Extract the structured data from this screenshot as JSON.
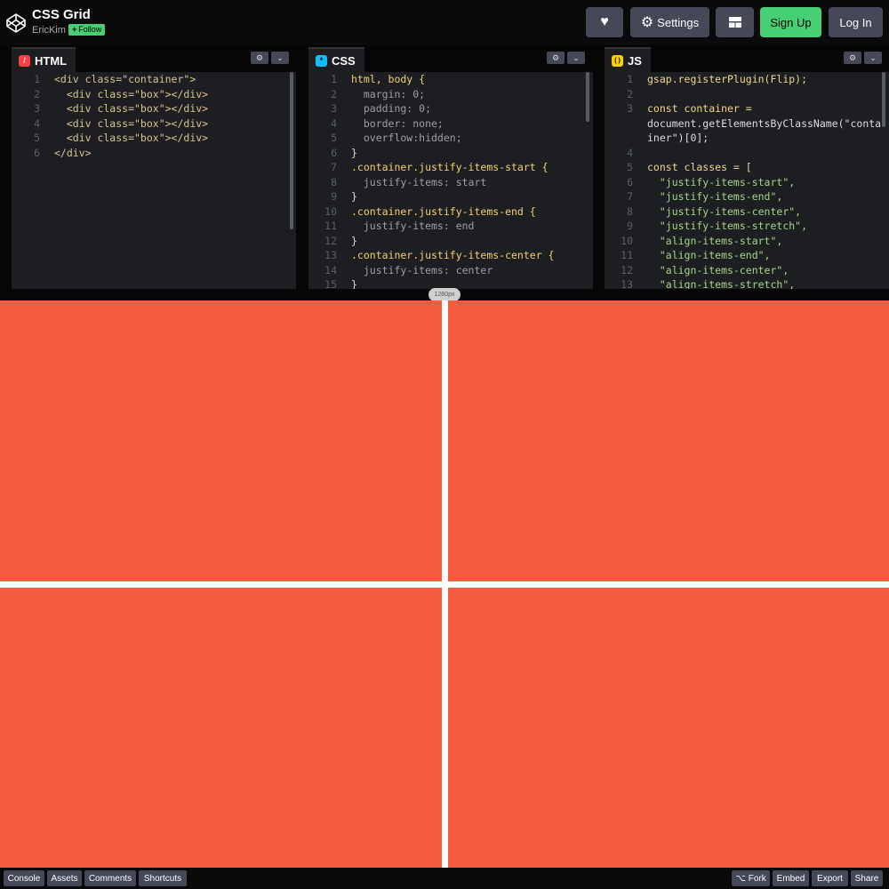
{
  "header": {
    "title": "CSS Grid",
    "author": "EricKim",
    "follow_label": "Follow",
    "follow_plus": "+",
    "heart_icon": "♥",
    "settings_icon": "⚙",
    "settings_label": "Settings",
    "layout_icon": "layout-icon",
    "signup_label": "Sign Up",
    "login_label": "Log In"
  },
  "editors": {
    "html": {
      "label": "HTML",
      "icon_glyph": "/",
      "icon_color": "#ff3c41",
      "lines": [
        [
          "1",
          "<div class=\"container\">"
        ],
        [
          "2",
          "  <div class=\"box\"></div>"
        ],
        [
          "3",
          "  <div class=\"box\"></div>"
        ],
        [
          "4",
          "  <div class=\"box\"></div>"
        ],
        [
          "5",
          "  <div class=\"box\"></div>"
        ],
        [
          "6",
          "</div>"
        ]
      ]
    },
    "css": {
      "label": "CSS",
      "icon_glyph": "*",
      "icon_color": "#0ebeff",
      "lines": [
        [
          "1",
          "html, body {"
        ],
        [
          "2",
          "  margin: 0;"
        ],
        [
          "3",
          "  padding: 0;"
        ],
        [
          "4",
          "  border: none;"
        ],
        [
          "5",
          "  overflow:hidden;"
        ],
        [
          "6",
          "}"
        ],
        [
          "7",
          ".container.justify-items-start {"
        ],
        [
          "8",
          "  justify-items: start"
        ],
        [
          "9",
          "}"
        ],
        [
          "10",
          ".container.justify-items-end {"
        ],
        [
          "11",
          "  justify-items: end"
        ],
        [
          "12",
          "}"
        ],
        [
          "13",
          ".container.justify-items-center {"
        ],
        [
          "14",
          "  justify-items: center"
        ],
        [
          "15",
          "}"
        ]
      ]
    },
    "js": {
      "label": "JS",
      "icon_glyph": "( )",
      "icon_color": "#fcd000",
      "lines": [
        [
          "1",
          "gsap.registerPlugin(Flip);"
        ],
        [
          "2",
          ""
        ],
        [
          "3",
          "const container ="
        ],
        [
          "",
          "document.getElementsByClassName(\"conta"
        ],
        [
          "",
          "iner\")[0];"
        ],
        [
          "4",
          ""
        ],
        [
          "5",
          "const classes = ["
        ],
        [
          "6",
          "  \"justify-items-start\","
        ],
        [
          "7",
          "  \"justify-items-end\","
        ],
        [
          "8",
          "  \"justify-items-center\","
        ],
        [
          "9",
          "  \"justify-items-stretch\","
        ],
        [
          "10",
          "  \"align-items-start\","
        ],
        [
          "11",
          "  \"align-items-end\","
        ],
        [
          "12",
          "  \"align-items-center\","
        ],
        [
          "13",
          "  \"align-items-stretch\","
        ]
      ]
    },
    "settings_glyph": "⚙",
    "collapse_glyph": "⌄"
  },
  "preview": {
    "width_label": "1280px",
    "box_color": "#f55d41"
  },
  "footer": {
    "console": "Console",
    "assets": "Assets",
    "comments": "Comments",
    "shortcuts": "Shortcuts",
    "fork_icon": "⌥",
    "fork": "Fork",
    "embed": "Embed",
    "export": "Export",
    "share": "Share"
  }
}
